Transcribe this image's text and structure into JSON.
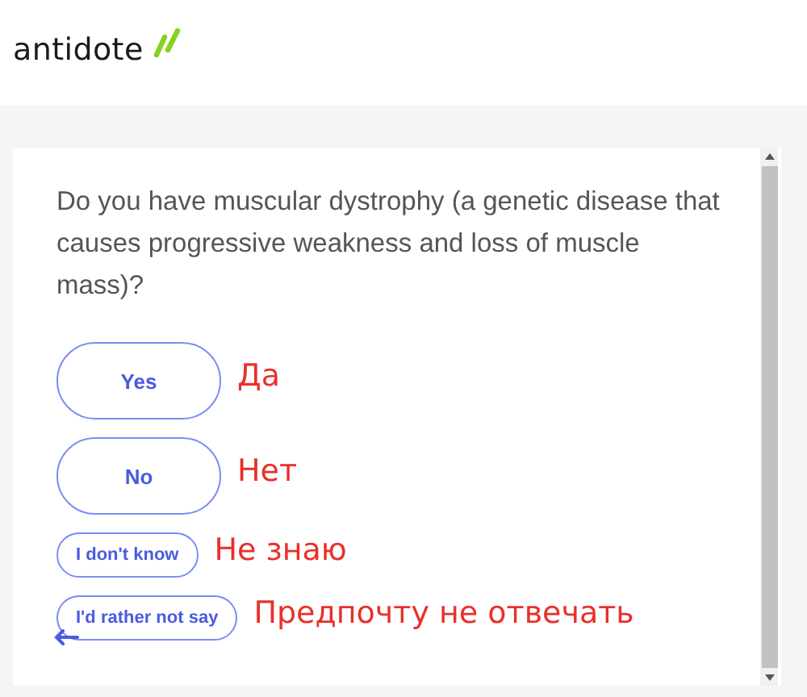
{
  "logo": {
    "text": "antidote"
  },
  "question": "Do you have muscular dystrophy (a genetic disease that causes progressive weakness and loss of muscle mass)?",
  "answers": [
    {
      "label": "Yes",
      "kind": "large",
      "note": "Да"
    },
    {
      "label": "No",
      "kind": "large",
      "note": "Нет"
    },
    {
      "label": "I don't know",
      "kind": "small",
      "note": "Не знаю"
    },
    {
      "label": "I'd rather not say",
      "kind": "small",
      "note": "Предпочту не отвечать"
    }
  ]
}
